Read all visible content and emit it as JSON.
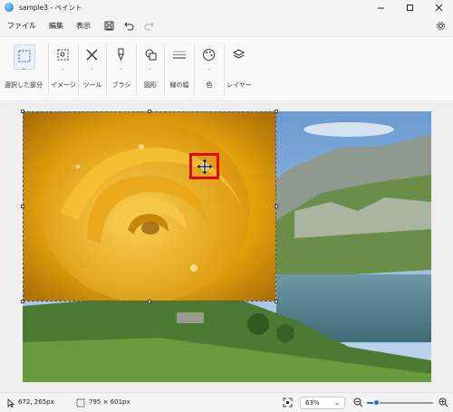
{
  "window": {
    "title": "sample3 - ペイント"
  },
  "menu": {
    "file": "ファイル",
    "edit": "編集",
    "view": "表示"
  },
  "ribbon": {
    "groups": {
      "selection": "選択した部分",
      "image": "イメージ",
      "tools": "ツール",
      "brushes": "ブラシ",
      "shapes": "図形",
      "size": "線の幅",
      "colors": "色",
      "layers": "レイヤー"
    }
  },
  "status": {
    "cursor_position": "672, 265px",
    "canvas_size": "795 × 601px",
    "zoom": "63%",
    "zoom_slider_level": 0.15
  },
  "colors": {
    "accent": "#1f6fd6",
    "highlight": "#e10a0a",
    "chevron": "#e0584f"
  }
}
